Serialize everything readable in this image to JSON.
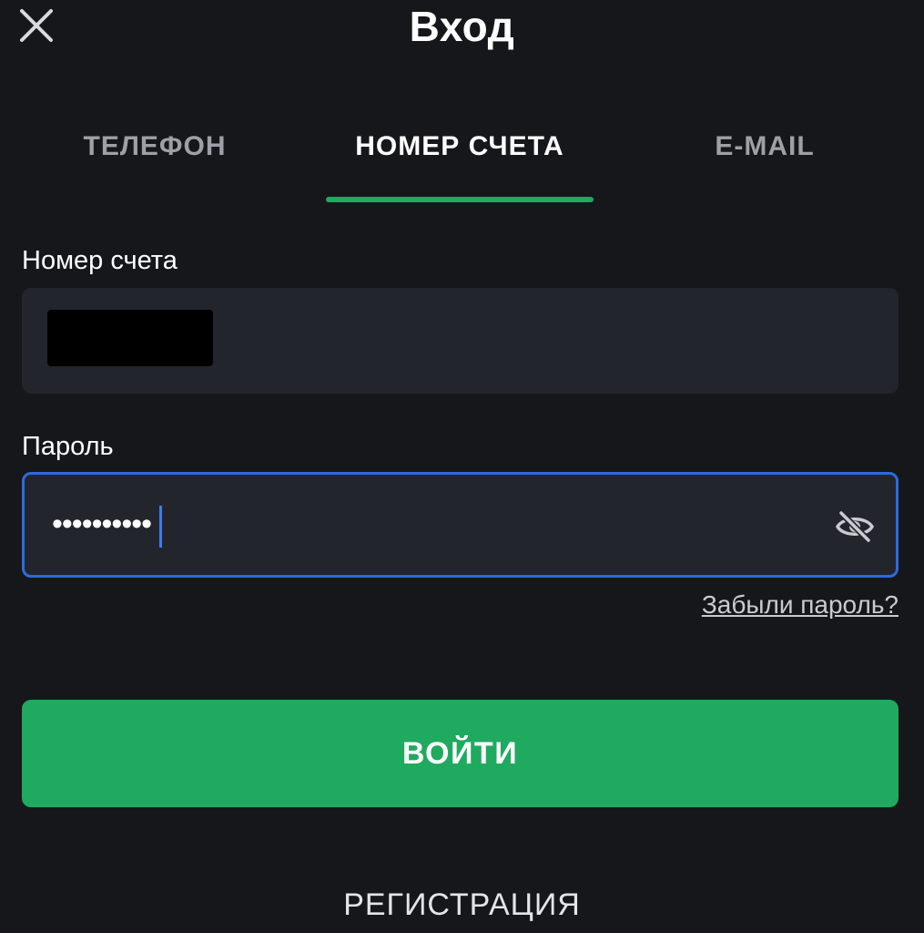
{
  "header": {
    "title": "Вход",
    "close_icon": "close-icon"
  },
  "tabs": [
    {
      "label": "ТЕЛЕФОН",
      "active": false
    },
    {
      "label": "НОМЕР СЧЕТА",
      "active": true
    },
    {
      "label": "E-MAIL",
      "active": false
    }
  ],
  "form": {
    "account_label": "Номер счета",
    "account_value_redacted": true,
    "password_label": "Пароль",
    "password_value": "••••••••••",
    "password_toggle_icon": "eye-off-icon",
    "forgot_password": "Забыли пароль?"
  },
  "actions": {
    "login_label": "ВОЙТИ",
    "register_label": "РЕГИСТРАЦИЯ"
  },
  "colors": {
    "background": "#16171b",
    "input_background": "#23252c",
    "accent_green": "#1faa5f",
    "focus_blue": "#2c6be0",
    "inactive_tab": "#9ea0a7"
  }
}
